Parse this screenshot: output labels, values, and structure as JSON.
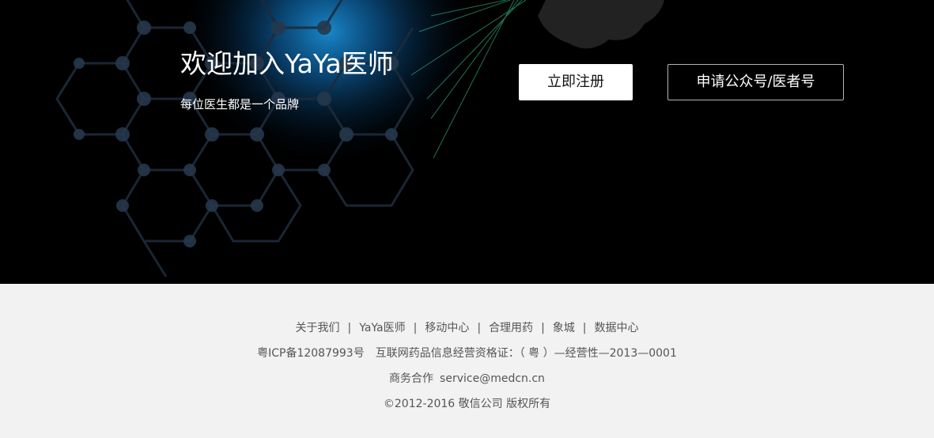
{
  "hero": {
    "title": "欢迎加入YaYa医师",
    "subtitle": "每位医生都是一个品牌",
    "register_button": "立即注册",
    "apply_button": "申请公众号/医者号",
    "background_color": "#000000",
    "accent_glow_color": "#1a8fd6",
    "line_color": "#3fd1a0"
  },
  "footer": {
    "background_color": "#f2f2f2",
    "links": [
      {
        "label": "关于我们"
      },
      {
        "label": "YaYa医师"
      },
      {
        "label": "移动中心"
      },
      {
        "label": "合理用药"
      },
      {
        "label": "象城"
      },
      {
        "label": "数据中心"
      }
    ],
    "separator": "|",
    "icp": "粤ICP备12087993号",
    "license": "互联网药品信息经营资格证：（ 粤 ）—经营性—2013—0001",
    "business_label": "商务合作",
    "business_email": "service@medcn.cn",
    "copyright": "©2012-2016 敬信公司 版权所有"
  }
}
